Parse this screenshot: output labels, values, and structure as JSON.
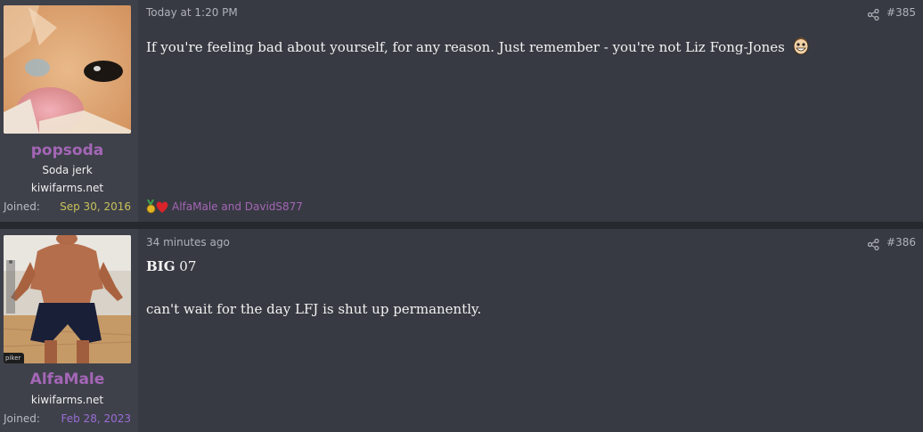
{
  "posts": [
    {
      "username": "popsoda",
      "user_title": "Soda jerk",
      "site": "kiwifarms.net",
      "joined_label": "Joined:",
      "joined_date": "Sep 30, 2016",
      "joined_color": "#c8c05a",
      "timestamp": "Today at 1:20 PM",
      "post_number": "#385",
      "body": "If you're feeling bad about yourself, for any reason. Just remember - you're not Liz Fong-Jones",
      "body_emoji": "grinning-face-emoji",
      "reactions": {
        "icons": [
          "medal-icon",
          "heart-icon"
        ],
        "users": "AlfaMale and DavidS877"
      }
    },
    {
      "username": "AlfaMale",
      "site": "kiwifarms.net",
      "avatar_watermark": "piker",
      "joined_label": "Joined:",
      "joined_date": "Feb 28, 2023",
      "joined_color": "#9b6cd6",
      "timestamp": "34 minutes ago",
      "post_number": "#386",
      "body_bold": "BIG",
      "body_after_bold": "07",
      "body_line2": "can't wait for the day LFJ is shut up permanently."
    }
  ],
  "colors": {
    "username": "#a466b6",
    "post_bg": "#373a42",
    "user_cell_bg": "#3e414a",
    "separator": "#26292e"
  }
}
